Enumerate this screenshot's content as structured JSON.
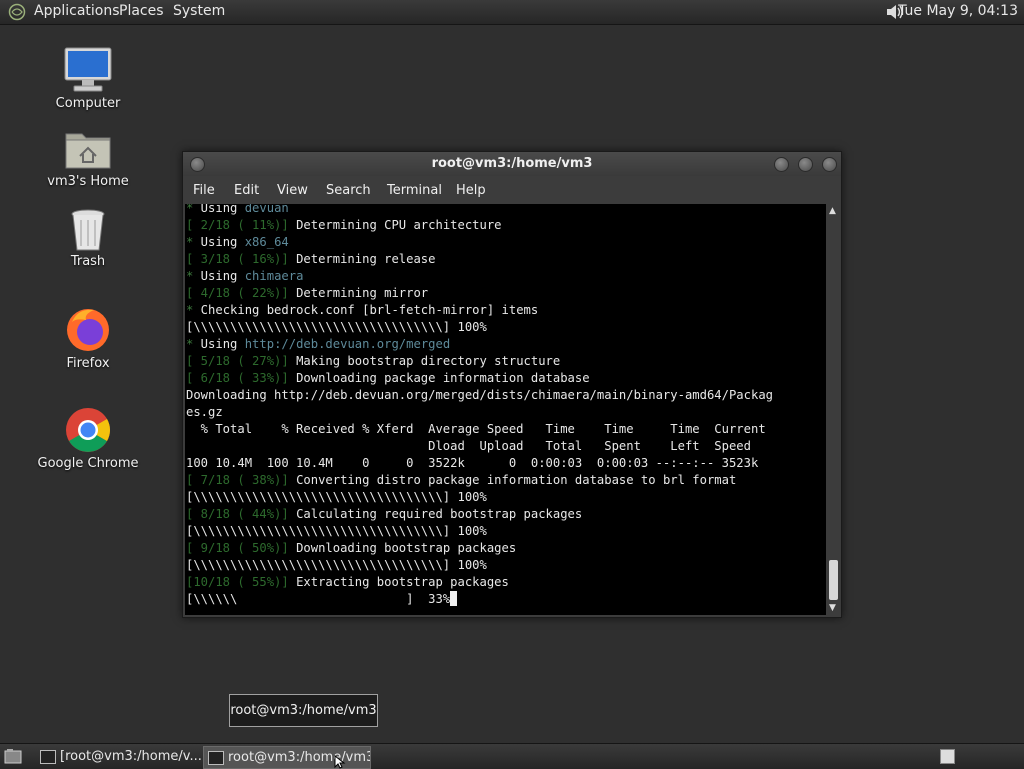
{
  "top_panel": {
    "menus": [
      "Applications",
      "Places",
      "System"
    ],
    "clock": "Tue May  9, 04:13"
  },
  "desktop_icons": [
    {
      "label": "Computer",
      "icon": "computer-icon"
    },
    {
      "label": "vm3's Home",
      "icon": "home-folder-icon"
    },
    {
      "label": "Trash",
      "icon": "trash-icon"
    },
    {
      "label": "Firefox",
      "icon": "firefox-icon"
    },
    {
      "label": "Google Chrome",
      "icon": "chrome-icon"
    }
  ],
  "terminal": {
    "title": "root@vm3:/home/vm3",
    "menu": [
      "File",
      "Edit",
      "View",
      "Search",
      "Terminal",
      "Help"
    ],
    "lines": [
      "* Using devuan",
      "[ 2/18 ( 11%)] Determining CPU architecture",
      "* Using x86_64",
      "[ 3/18 ( 16%)] Determining release",
      "* Using chimaera",
      "[ 4/18 ( 22%)] Determining mirror",
      "* Checking bedrock.conf [brl-fetch-mirror] items",
      "[\\\\\\\\\\\\\\\\\\\\\\\\\\\\\\\\\\\\\\\\\\\\\\\\\\\\\\\\\\\\\\\\\\\\] 100%",
      "* Using http://deb.devuan.org/merged",
      "[ 5/18 ( 27%)] Making bootstrap directory structure",
      "[ 6/18 ( 33%)] Downloading package information database",
      "Downloading http://deb.devuan.org/merged/dists/chimaera/main/binary-amd64/Packag",
      "es.gz",
      "  % Total    % Received % Xferd  Average Speed   Time    Time     Time  Current",
      "                                 Dload  Upload   Total   Spent    Left  Speed",
      "100 10.4M  100 10.4M    0     0  3522k      0  0:00:03  0:00:03 --:--:-- 3523k",
      "[ 7/18 ( 38%)] Converting distro package information database to brl format",
      "[\\\\\\\\\\\\\\\\\\\\\\\\\\\\\\\\\\\\\\\\\\\\\\\\\\\\\\\\\\\\\\\\\\\\] 100%",
      "[ 8/18 ( 44%)] Calculating required bootstrap packages",
      "[\\\\\\\\\\\\\\\\\\\\\\\\\\\\\\\\\\\\\\\\\\\\\\\\\\\\\\\\\\\\\\\\\\\\] 100%",
      "[ 9/18 ( 50%)] Downloading bootstrap packages",
      "[\\\\\\\\\\\\\\\\\\\\\\\\\\\\\\\\\\\\\\\\\\\\\\\\\\\\\\\\\\\\\\\\\\\\] 100%",
      "[10/18 ( 55%)] Extracting bootstrap packages",
      "[\\\\\\\\\\\\                       ]  33%"
    ]
  },
  "tooltip": "root@vm3:/home/vm3",
  "taskbar": {
    "tasks": [
      "[root@vm3:/home/v...",
      "root@vm3:/home/vm3"
    ]
  }
}
